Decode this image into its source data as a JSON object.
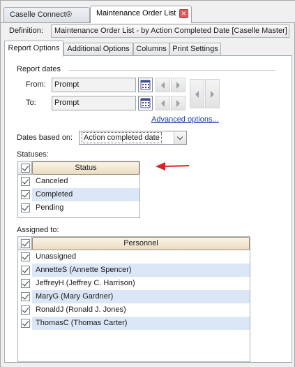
{
  "doc_tabs": [
    {
      "label": "Caselle Connect®",
      "active": false
    },
    {
      "label": "Maintenance Order List",
      "active": true,
      "close": "×"
    }
  ],
  "definition": {
    "label": "Definition:",
    "value": "Maintenance Order List - by Action Completed Date [Caselle Master]"
  },
  "sub_tabs": [
    {
      "label": "Report Options",
      "active": true
    },
    {
      "label": "Additional Options",
      "active": false
    },
    {
      "label": "Columns",
      "active": false
    },
    {
      "label": "Print Settings",
      "active": false
    }
  ],
  "report_dates": {
    "title": "Report dates",
    "from_label": "From:",
    "from_value": "Prompt",
    "to_label": "To:",
    "to_value": "Prompt",
    "advanced_link": "Advanced options..."
  },
  "dates_based_on": {
    "label": "Dates based on:",
    "value": "Action completed date"
  },
  "statuses": {
    "label": "Statuses:",
    "header": "Status",
    "header_checked": true,
    "rows": [
      {
        "text": "Canceled",
        "checked": true
      },
      {
        "text": "Completed",
        "checked": true
      },
      {
        "text": "Pending",
        "checked": true
      }
    ]
  },
  "assigned_to": {
    "label": "Assigned to:",
    "header": "Personnel",
    "header_checked": true,
    "rows": [
      {
        "text": "Unassigned",
        "checked": true
      },
      {
        "text": "AnnetteS (Annette Spencer)",
        "checked": true
      },
      {
        "text": "JeffreyH (Jeffrey C. Harrison)",
        "checked": true
      },
      {
        "text": "MaryG (Mary Gardner)",
        "checked": true
      },
      {
        "text": "RonaldJ (Ronald J. Jones)",
        "checked": true
      },
      {
        "text": "ThomasC (Thomas Carter)",
        "checked": true
      }
    ]
  },
  "colors": {
    "accent_arrow": "#e02020",
    "row_alt": "#dbe6f6",
    "grid_header": "#eadcc2",
    "link": "#1a3fb0"
  }
}
